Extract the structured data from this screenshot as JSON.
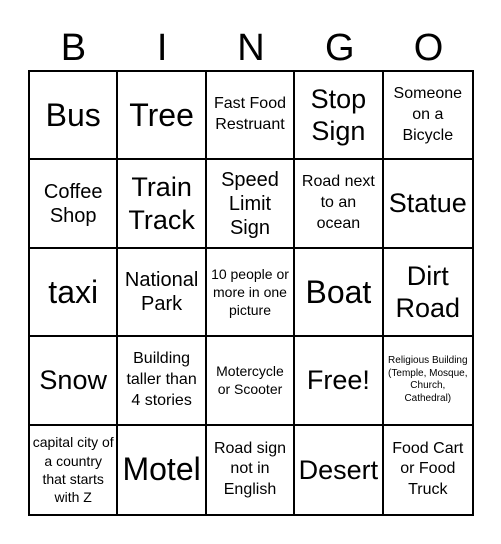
{
  "header": {
    "letters": [
      "B",
      "I",
      "N",
      "G",
      "O"
    ]
  },
  "cells": [
    "Bus",
    "Tree",
    "Fast Food Restruant",
    "Stop Sign",
    "Someone on a Bicycle",
    "Coffee Shop",
    "Train Track",
    "Speed Limit Sign",
    "Road next to an ocean",
    "Statue",
    "taxi",
    "National Park",
    "10 people or more in one picture",
    "Boat",
    "Dirt Road",
    "Snow",
    "Building taller than 4 stories",
    "Motercycle or Scooter",
    "Free!",
    "Religious Building (Temple, Mosque, Church, Cathedral)",
    "capital city of a country that starts with Z",
    "Motel",
    "Road sign not in English",
    "Desert",
    "Food Cart or Food Truck"
  ],
  "free_space": {
    "row": 4,
    "col": 4,
    "label": "Free!"
  }
}
